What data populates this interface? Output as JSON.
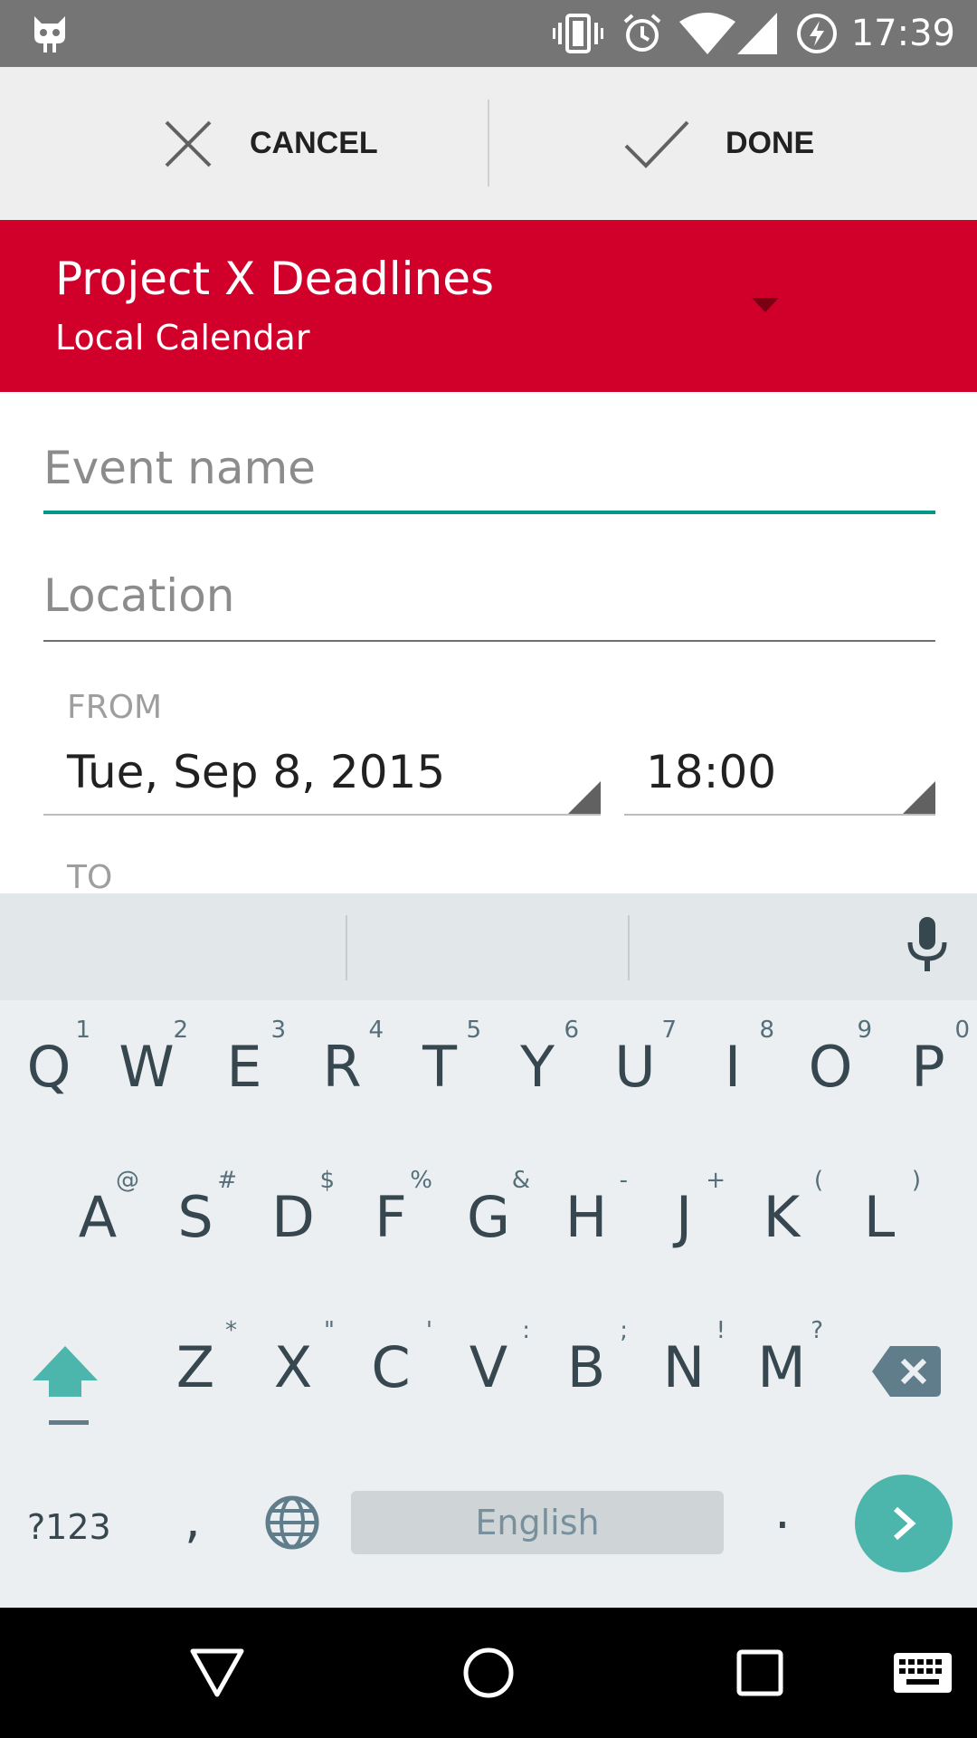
{
  "status_bar": {
    "time": "17:39",
    "icons": [
      "cyanogen-icon",
      "vibrate-icon",
      "alarm-icon",
      "wifi-icon",
      "signal-icon",
      "battery-charging-icon"
    ]
  },
  "action_bar": {
    "cancel_label": "CANCEL",
    "done_label": "DONE"
  },
  "calendar": {
    "name": "Project X Deadlines",
    "account": "Local Calendar",
    "color": "#d0002b"
  },
  "form": {
    "event_name_placeholder": "Event name",
    "event_name_value": "",
    "location_placeholder": "Location",
    "location_value": "",
    "from_label": "FROM",
    "from_date": "Tue, Sep 8, 2015",
    "from_time": "18:00",
    "to_label": "TO"
  },
  "keyboard": {
    "rows": [
      [
        {
          "k": "Q",
          "h": "1"
        },
        {
          "k": "W",
          "h": "2"
        },
        {
          "k": "E",
          "h": "3"
        },
        {
          "k": "R",
          "h": "4"
        },
        {
          "k": "T",
          "h": "5"
        },
        {
          "k": "Y",
          "h": "6"
        },
        {
          "k": "U",
          "h": "7"
        },
        {
          "k": "I",
          "h": "8"
        },
        {
          "k": "O",
          "h": "9"
        },
        {
          "k": "P",
          "h": "0"
        }
      ],
      [
        {
          "k": "A",
          "h": "@"
        },
        {
          "k": "S",
          "h": "#"
        },
        {
          "k": "D",
          "h": "$"
        },
        {
          "k": "F",
          "h": "%"
        },
        {
          "k": "G",
          "h": "&"
        },
        {
          "k": "H",
          "h": "-"
        },
        {
          "k": "J",
          "h": "+"
        },
        {
          "k": "K",
          "h": "("
        },
        {
          "k": "L",
          "h": ")"
        }
      ],
      [
        {
          "k": "Z",
          "h": "*"
        },
        {
          "k": "X",
          "h": "\""
        },
        {
          "k": "C",
          "h": "'"
        },
        {
          "k": "V",
          "h": ":"
        },
        {
          "k": "B",
          "h": ";"
        },
        {
          "k": "N",
          "h": "!"
        },
        {
          "k": "M",
          "h": "?"
        }
      ]
    ],
    "symbols_label": "?123",
    "comma": ",",
    "space_label": "English",
    "period": ".",
    "accent_color": "#4db6ac"
  },
  "nav_bar": {
    "icons": [
      "back-icon",
      "home-icon",
      "recents-icon",
      "keyboard-icon"
    ]
  }
}
